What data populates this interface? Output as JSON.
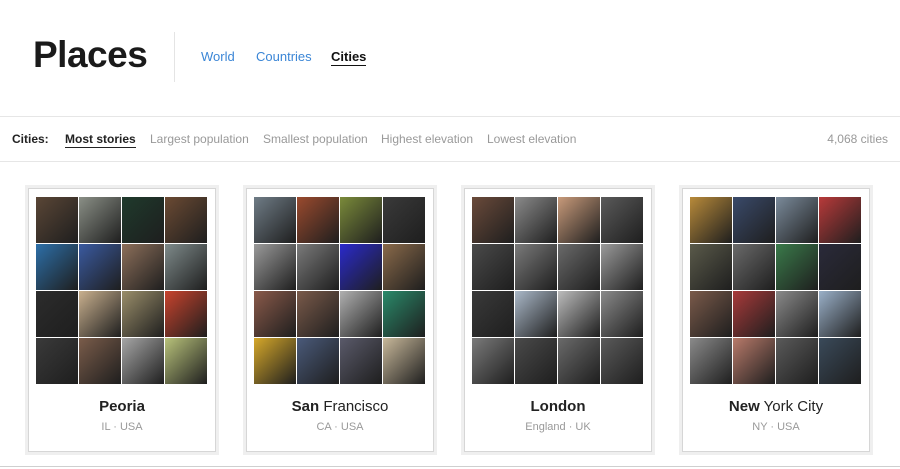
{
  "header": {
    "title": "Places",
    "nav": [
      {
        "label": "World",
        "active": false
      },
      {
        "label": "Countries",
        "active": false
      },
      {
        "label": "Cities",
        "active": true
      }
    ]
  },
  "filters": {
    "label": "Cities:",
    "options": [
      {
        "label": "Most stories",
        "active": true
      },
      {
        "label": "Largest population",
        "active": false
      },
      {
        "label": "Smallest population",
        "active": false
      },
      {
        "label": "Highest elevation",
        "active": false
      },
      {
        "label": "Lowest elevation",
        "active": false
      }
    ],
    "count": "4,068 cities"
  },
  "cities": [
    {
      "name_bold": "Peoria",
      "name_rest": "",
      "region": "IL · USA",
      "photos": [
        "#5a4636",
        "#8a8f86",
        "#1f3a2c",
        "#6b4a33",
        "#2d6fa8",
        "#3a5aa0",
        "#8c6f5a",
        "#7e8a8a",
        "#2c2c2c",
        "#c9b08e",
        "#9a8e6a",
        "#c8432d",
        "#3a3a3a",
        "#7a5c4a",
        "#a6a6a6",
        "#b8c27a"
      ]
    },
    {
      "name_bold": "San",
      "name_rest": " Francisco",
      "region": "CA · USA",
      "photos": [
        "#6f7c86",
        "#9a4a2e",
        "#7a8a3a",
        "#3a3a3a",
        "#9a9a9a",
        "#7a7a7a",
        "#2a2acc",
        "#8a6a4a",
        "#8a5a4a",
        "#7a5a4a",
        "#b0b0b0",
        "#2a8a6a",
        "#d6a82a",
        "#4a5a7a",
        "#5a5a6a",
        "#c8b89a"
      ]
    },
    {
      "name_bold": "London",
      "name_rest": "",
      "region": "England · UK",
      "photos": [
        "#6a4a3a",
        "#8a8a8a",
        "#c89a7a",
        "#5a5a5a",
        "#4a4a4a",
        "#7a7a7a",
        "#6a6a6a",
        "#9a9a9a",
        "#3a3a3a",
        "#aab8c8",
        "#bcbcbc",
        "#8a8a8a",
        "#7a7a7a",
        "#4a4a4a",
        "#6a6a6a",
        "#5a5a5a"
      ]
    },
    {
      "name_bold": "New",
      "name_rest": " York City",
      "region": "NY · USA",
      "photos": [
        "#b88a3a",
        "#3a4a6a",
        "#7a8a9a",
        "#b83a3a",
        "#5a5a4a",
        "#6a6a6a",
        "#3a7a4a",
        "#2a2a3a",
        "#7a5a4a",
        "#a83a3a",
        "#8a8a8a",
        "#9ab0c8",
        "#8a8a8a",
        "#b87a6a",
        "#5a5a5a",
        "#3a4a5a"
      ]
    }
  ]
}
